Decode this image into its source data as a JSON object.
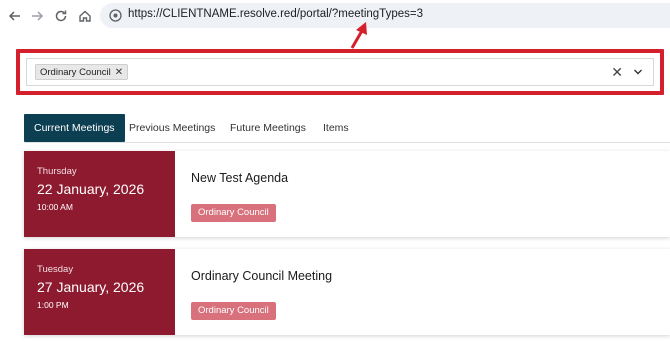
{
  "browser": {
    "url": "https://CLIENTNAME.resolve.red/portal/?meetingTypes=3"
  },
  "filter": {
    "selected_chip": "Ordinary Council",
    "chip_remove": "✕",
    "clear_all": "✕"
  },
  "tabs": [
    {
      "label": "Current Meetings",
      "active": true
    },
    {
      "label": "Previous Meetings",
      "active": false
    },
    {
      "label": "Future Meetings",
      "active": false
    },
    {
      "label": "Items",
      "active": false
    }
  ],
  "meetings": [
    {
      "weekday": "Thursday",
      "date": "22 January, 2026",
      "time": "10:00 AM",
      "title": "New Test Agenda",
      "type": "Ordinary Council"
    },
    {
      "weekday": "Tuesday",
      "date": "27 January, 2026",
      "time": "1:00 PM",
      "title": "Ordinary Council Meeting",
      "type": "Ordinary Council"
    }
  ],
  "colors": {
    "annotation": "#d3202c",
    "active_tab": "#0d3f52",
    "date_panel": "#8e1a2f",
    "badge": "#d9717c"
  }
}
